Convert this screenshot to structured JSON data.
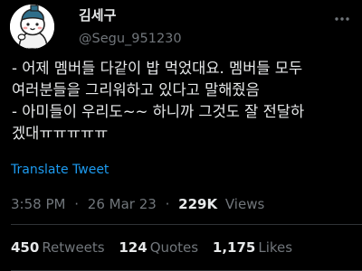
{
  "author": {
    "display_name": "김세구",
    "handle": "@Segu_951230"
  },
  "tweet": {
    "lines": [
      "- 어제 멤버들 다같이 밥 먹었대요. 멤버들 모두",
      "여러분들을 그리워하고 있다고 말해줬음",
      "- 아미들이 우리도~~ 하니까 그것도 잘 전달하",
      "겠대ㅠㅠㅠㅠㅠ"
    ],
    "translate_label": "Translate Tweet"
  },
  "meta": {
    "time": "3:58 PM",
    "separator": "·",
    "date": "26 Mar 23",
    "views_count": "229K",
    "views_label": "Views"
  },
  "stats": {
    "retweets_count": "450",
    "retweets_label": "Retweets",
    "quotes_count": "124",
    "quotes_label": "Quotes",
    "likes_count": "1,175",
    "likes_label": "Likes"
  },
  "colors": {
    "background": "#000000",
    "text_primary": "#e7e9ea",
    "text_secondary": "#71767b",
    "link": "#1d9bf0",
    "divider": "#2f3336",
    "avatar_hat": "#2f6e8a"
  },
  "icons": {
    "more": "more-horizontal-icon",
    "avatar": "cartoon-avatar"
  }
}
